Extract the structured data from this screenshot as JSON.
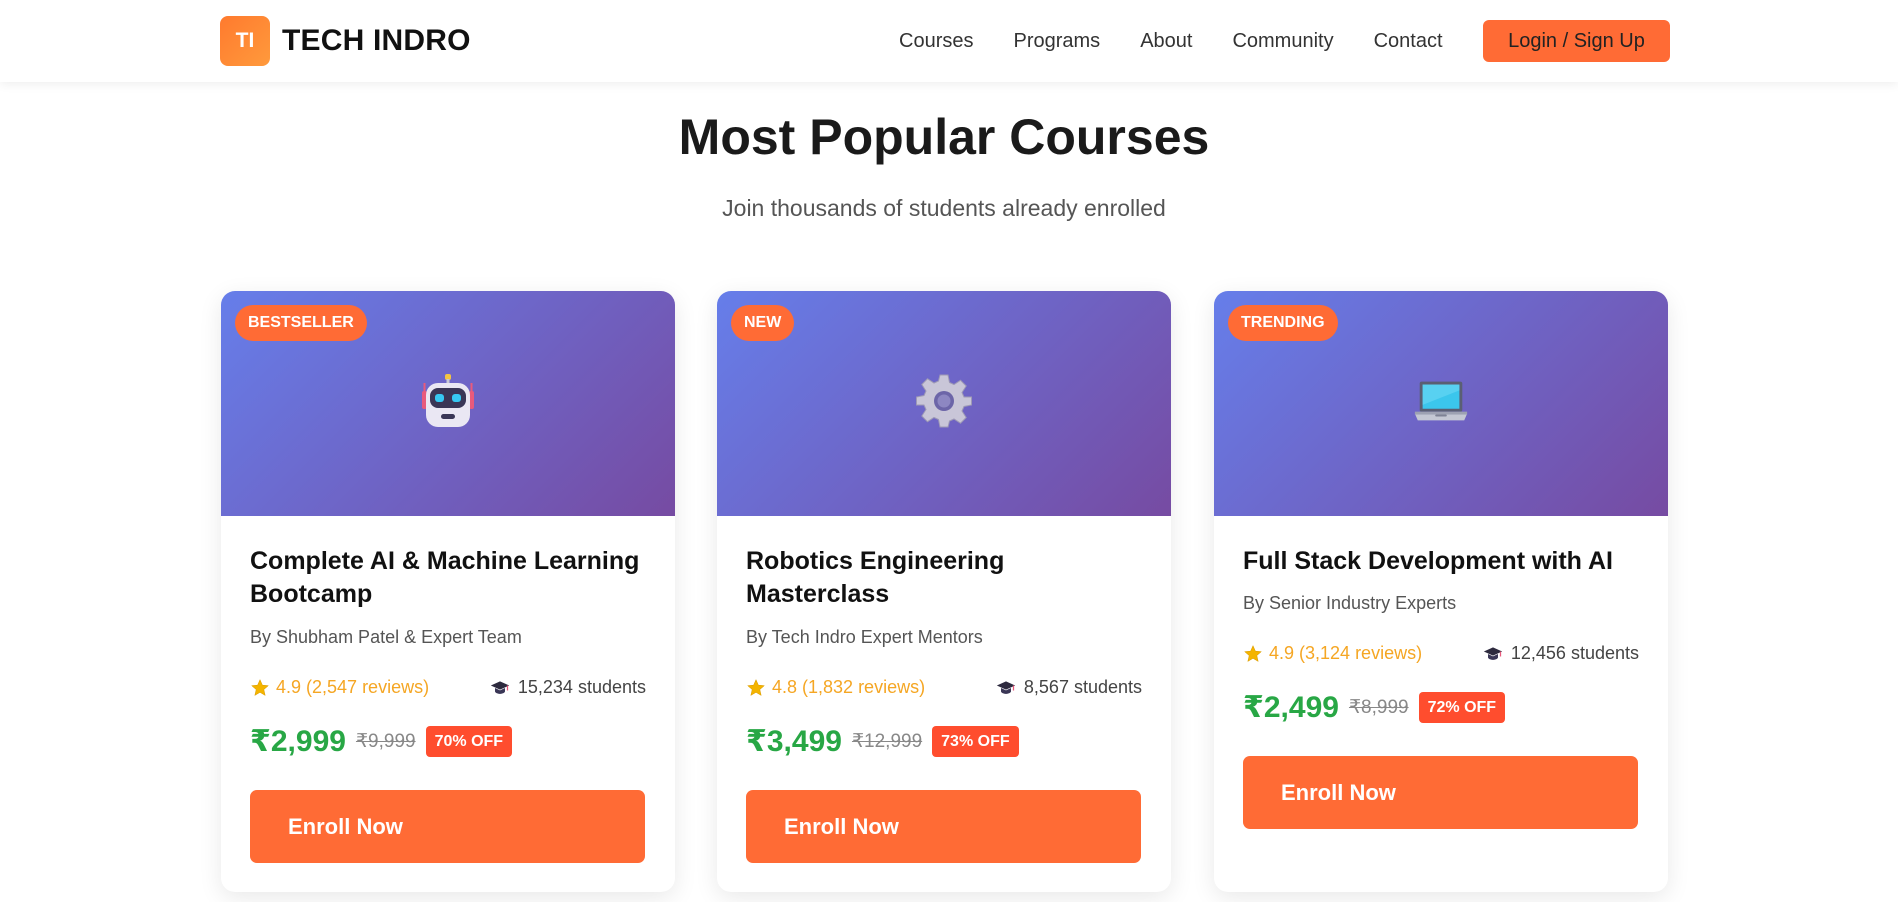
{
  "brand": {
    "logo_mark": "TI",
    "name": "TECH INDRO",
    "accent": "#ff6b35"
  },
  "nav": {
    "links": [
      "Courses",
      "Programs",
      "About",
      "Community",
      "Contact"
    ],
    "login_label": "Login / Sign Up"
  },
  "section": {
    "title": "Most Popular Courses",
    "subtitle": "Join thousands of students already enrolled"
  },
  "courses": [
    {
      "badge": "BESTSELLER",
      "icon": "robot-icon",
      "title": "Complete AI & Machine Learning Bootcamp",
      "author": "By Shubham Patel & Expert Team",
      "rating": "4.9 (2,547 reviews)",
      "students": "15,234 students",
      "price": "₹2,999",
      "old_price": "₹9,999",
      "discount": "70% OFF",
      "cta": "Enroll Now"
    },
    {
      "badge": "NEW",
      "icon": "gear-icon",
      "title": "Robotics Engineering Masterclass",
      "author": "By Tech Indro Expert Mentors",
      "rating": "4.8 (1,832 reviews)",
      "students": "8,567 students",
      "price": "₹3,499",
      "old_price": "₹12,999",
      "discount": "73% OFF",
      "cta": "Enroll Now"
    },
    {
      "badge": "TRENDING",
      "icon": "laptop-icon",
      "title": "Full Stack Development with AI",
      "author": "By Senior Industry Experts",
      "rating": "4.9 (3,124 reviews)",
      "students": "12,456 students",
      "price": "₹2,499",
      "old_price": "₹8,999",
      "discount": "72% OFF",
      "cta": "Enroll Now"
    }
  ],
  "colors": {
    "hero_gradient_start": "#667eea",
    "hero_gradient_end": "#764ba2",
    "price_green": "#28a745",
    "discount_red": "#ff4d2e",
    "rating_gold": "#f5a623"
  }
}
